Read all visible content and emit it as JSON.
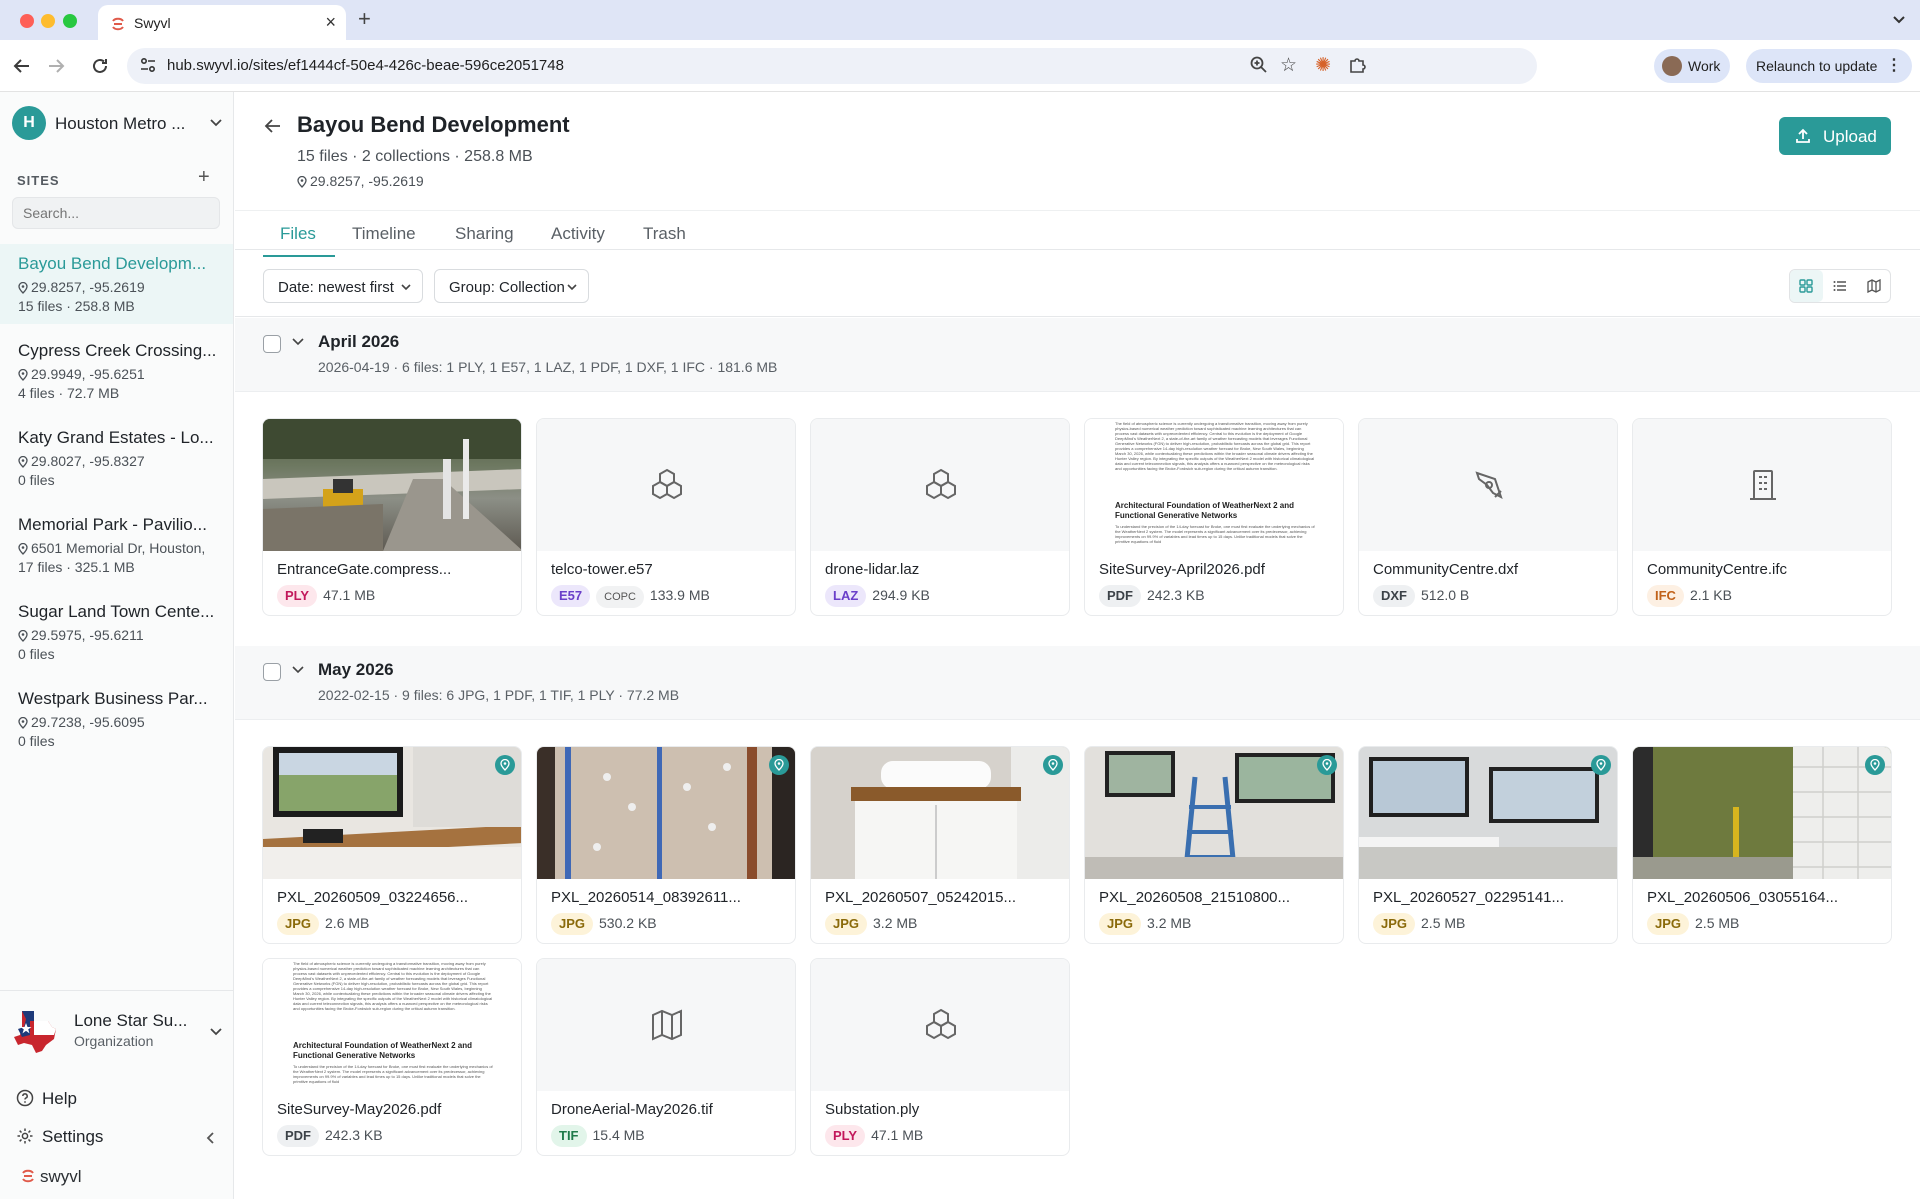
{
  "browser": {
    "tab_title": "Swyvl",
    "url": "hub.swyvl.io/sites/ef1444cf-50e4-426c-beae-596ce2051748",
    "profile_label": "Work",
    "relaunch_label": "Relaunch to update"
  },
  "sidebar": {
    "org_initial": "H",
    "org_name": "Houston Metro ...",
    "sites_heading": "SITES",
    "search_placeholder": "Search...",
    "sites": [
      {
        "name": "Bayou Bend Developm...",
        "coords": "29.8257, -95.2619",
        "stats": "15 files · 258.8 MB"
      },
      {
        "name": "Cypress Creek Crossing...",
        "coords": "29.9949, -95.6251",
        "stats": "4 files · 72.7 MB"
      },
      {
        "name": "Katy Grand Estates - Lo...",
        "coords": "29.8027, -95.8327",
        "stats": "0 files"
      },
      {
        "name": "Memorial Park - Pavilio...",
        "coords": "6501 Memorial Dr, Houston,",
        "stats": "17 files · 325.1 MB"
      },
      {
        "name": "Sugar Land Town Cente...",
        "coords": "29.5975, -95.6211",
        "stats": "0 files"
      },
      {
        "name": "Westpark Business Par...",
        "coords": "29.7238, -95.6095",
        "stats": "0 files"
      }
    ],
    "organization": {
      "name": "Lone Star Su...",
      "role": "Organization"
    },
    "help_label": "Help",
    "settings_label": "Settings",
    "brand": "swyvl"
  },
  "page": {
    "title": "Bayou Bend Development",
    "subtitle": "15 files · 2 collections · 258.8 MB",
    "coords": "29.8257, -95.2619",
    "upload_label": "Upload"
  },
  "tabs": [
    "Files",
    "Timeline",
    "Sharing",
    "Activity",
    "Trash"
  ],
  "filters": {
    "sort": "Date: newest first",
    "group": "Group: Collection"
  },
  "groups": [
    {
      "name": "April 2026",
      "summary": "2026-04-19 · 6 files: 1 PLY, 1 E57, 1 LAZ, 1 PDF, 1 DXF, 1 IFC · 181.6 MB",
      "files": [
        {
          "name": "EntranceGate.compress...",
          "type": "PLY",
          "size": "47.1 MB"
        },
        {
          "name": "telco-tower.e57",
          "type": "E57",
          "tag": "COPC",
          "size": "133.9 MB"
        },
        {
          "name": "drone-lidar.laz",
          "type": "LAZ",
          "size": "294.9 KB"
        },
        {
          "name": "SiteSurvey-April2026.pdf",
          "type": "PDF",
          "size": "242.3 KB"
        },
        {
          "name": "CommunityCentre.dxf",
          "type": "DXF",
          "size": "512.0 B"
        },
        {
          "name": "CommunityCentre.ifc",
          "type": "IFC",
          "size": "2.1 KB"
        }
      ]
    },
    {
      "name": "May 2026",
      "summary": "2022-02-15 · 9 files: 6 JPG, 1 PDF, 1 TIF, 1 PLY · 77.2 MB",
      "files": [
        {
          "name": "PXL_20260509_03224656...",
          "type": "JPG",
          "size": "2.6 MB"
        },
        {
          "name": "PXL_20260514_08392611...",
          "type": "JPG",
          "size": "530.2 KB"
        },
        {
          "name": "PXL_20260507_05242015...",
          "type": "JPG",
          "size": "3.2 MB"
        },
        {
          "name": "PXL_20260508_21510800...",
          "type": "JPG",
          "size": "3.2 MB"
        },
        {
          "name": "PXL_20260527_02295141...",
          "type": "JPG",
          "size": "2.5 MB"
        },
        {
          "name": "PXL_20260506_03055164...",
          "type": "JPG",
          "size": "2.5 MB"
        },
        {
          "name": "SiteSurvey-May2026.pdf",
          "type": "PDF",
          "size": "242.3 KB"
        },
        {
          "name": "DroneAerial-May2026.tif",
          "type": "TIF",
          "size": "15.4 MB"
        },
        {
          "name": "Substation.ply",
          "type": "PLY",
          "size": "47.1 MB"
        }
      ]
    }
  ],
  "pdf_preview": {
    "heading": "Architectural Foundation of WeatherNext 2 and Functional Generative Networks",
    "body": "The field of atmospheric science is currently undergoing a transformative transition, moving away from purely physics-based numerical weather prediction toward sophisticated machine learning architectures that can process vast datasets with unprecedented efficiency. Central to this evolution is the deployment of Google DeepMind's WeatherNext 2, a state-of-the-art family of weather forecasting models that leverages Functional Generative Networks (FGN) to deliver high-resolution, probabilistic forecasts across the global grid. This report provides a comprehensive 14-day high-resolution weather forecast for Broke, New South Wales, beginning March 30, 2026, while contextualizing these predictions within the broader seasonal climate drivers affecting the Hunter Valley region. By integrating the specific outputs of the WeatherNext 2 model with historical climatological data and current teleconnection signals, this analysis offers a nuanced perspective on the meteorological risks and opportunities facing the Broke-Fordwich sub-region during the critical autumn transition.",
    "footer": "To understand the precision of the 14-day forecast for Broke, one must first evaluate the underlying mechanics of the WeatherNext 2 system. The model represents a significant advancement over its predecessor, achieving improvements on 99.9% of variables and lead times up to 15 days. Unlike traditional models that solve the primitive equations of fluid"
  },
  "colors": {
    "accent": "#2a9a98",
    "PLY": "#fde7ec",
    "PLY_text": "#c2185b",
    "E57": "#ece7fb",
    "E57_text": "#6a3fc9",
    "LAZ": "#ece7fb",
    "LAZ_text": "#6a3fc9",
    "PDF": "#eef0f2",
    "PDF_text": "#3c4248",
    "DXF": "#eef0f2",
    "DXF_text": "#3c4248",
    "IFC": "#fdf0e3",
    "IFC_text": "#c1621a",
    "JPG": "#fdf3d9",
    "JPG_text": "#8a6a0a",
    "TIF": "#e2f5ea",
    "TIF_text": "#1f7a4a"
  }
}
